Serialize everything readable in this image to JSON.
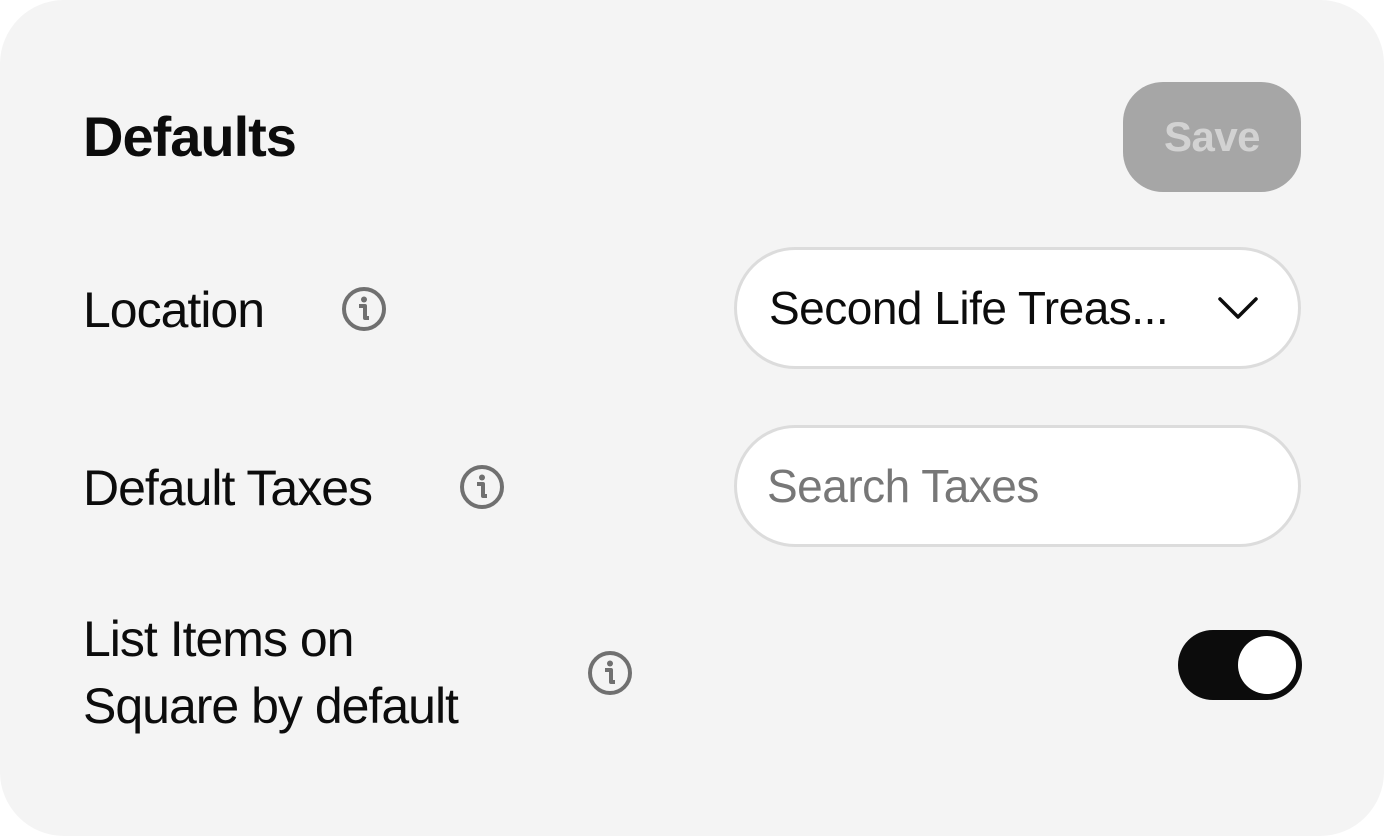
{
  "header": {
    "title": "Defaults",
    "save_label": "Save"
  },
  "location": {
    "label": "Location",
    "selected_value": "Second Life Treas..."
  },
  "default_taxes": {
    "label": "Default Taxes",
    "placeholder": "Search Taxes",
    "value": ""
  },
  "list_on_square": {
    "label_line1": "List Items on",
    "label_line2": "Square by default",
    "enabled": true
  },
  "icons": {
    "info": "info-icon",
    "dropdown": "chevron-down-icon"
  },
  "colors": {
    "card_background": "#f4f4f4",
    "save_disabled_bg": "#a6a6a6",
    "save_disabled_text": "#d2d2d2",
    "toggle_on": "#0c0c0c",
    "info_icon": "#707070"
  }
}
